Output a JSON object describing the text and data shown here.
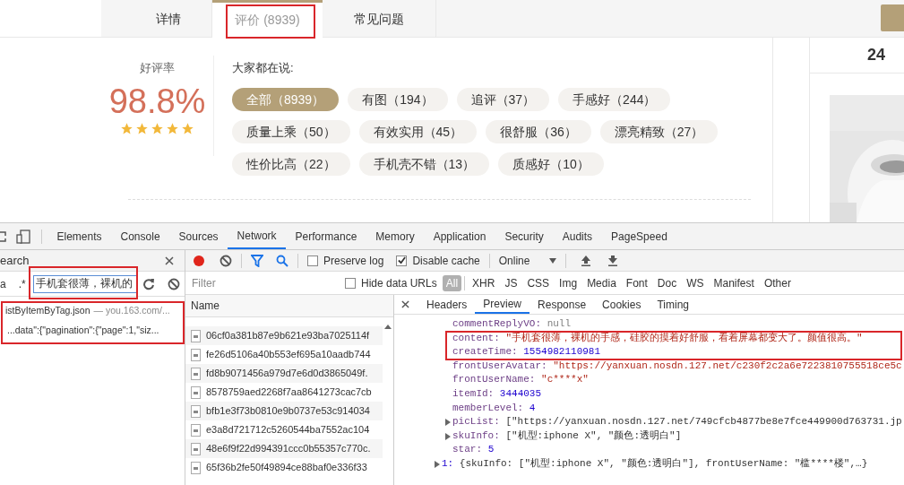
{
  "page": {
    "tabs": [
      {
        "label": "详情",
        "selected": false
      },
      {
        "label": "评价 (8939)",
        "selected": true
      },
      {
        "label": "常见问题",
        "selected": false
      }
    ],
    "rating": {
      "label": "好评率",
      "value": "98.8%",
      "stars": 5
    },
    "tags_title": "大家都在说:",
    "tag_rows": [
      [
        {
          "label": "全部（8939）",
          "selected": true
        },
        {
          "label": "有图（194）",
          "selected": false
        },
        {
          "label": "追评（37）",
          "selected": false
        },
        {
          "label": "手感好（244）",
          "selected": false
        }
      ],
      [
        {
          "label": "质量上乘（50）",
          "selected": false
        },
        {
          "label": "有效实用（45）",
          "selected": false
        },
        {
          "label": "很舒服（36）",
          "selected": false
        },
        {
          "label": "漂亮精致（27）",
          "selected": false
        }
      ],
      [
        {
          "label": "性价比高（22）",
          "selected": false
        },
        {
          "label": "手机壳不错（13）",
          "selected": false
        },
        {
          "label": "质感好（10）",
          "selected": false
        }
      ]
    ],
    "side_heading": "24"
  },
  "devtools": {
    "tabs": [
      {
        "label": "Elements",
        "selected": false
      },
      {
        "label": "Console",
        "selected": false
      },
      {
        "label": "Sources",
        "selected": false
      },
      {
        "label": "Network",
        "selected": true
      },
      {
        "label": "Performance",
        "selected": false
      },
      {
        "label": "Memory",
        "selected": false
      },
      {
        "label": "Application",
        "selected": false
      },
      {
        "label": "Security",
        "selected": false
      },
      {
        "label": "Audits",
        "selected": false
      },
      {
        "label": "PageSpeed",
        "selected": false
      }
    ],
    "search_panel": {
      "title": "earch",
      "case_label": "a",
      "regex_label": ".*",
      "query": "手机套很薄，裸机的",
      "result_file": "istByItemByTag.json",
      "result_source": "— you.163.com/...",
      "result_match": "...data\":{\"pagination\":{\"page\":1,\"siz..."
    },
    "toolbar": {
      "preserve_log": {
        "label": "Preserve log",
        "checked": false
      },
      "disable_cache": {
        "label": "Disable cache",
        "checked": true
      },
      "throttle": "Online"
    },
    "filter": {
      "placeholder": "Filter",
      "hide_data_urls": {
        "label": "Hide data URLs",
        "checked": false
      },
      "types": [
        {
          "label": "All",
          "selected": true
        },
        {
          "label": "XHR",
          "selected": false
        },
        {
          "label": "JS",
          "selected": false
        },
        {
          "label": "CSS",
          "selected": false
        },
        {
          "label": "Img",
          "selected": false
        },
        {
          "label": "Media",
          "selected": false
        },
        {
          "label": "Font",
          "selected": false
        },
        {
          "label": "Doc",
          "selected": false
        },
        {
          "label": "WS",
          "selected": false
        },
        {
          "label": "Manifest",
          "selected": false
        },
        {
          "label": "Other",
          "selected": false
        }
      ]
    },
    "name_header": "Name",
    "requests": [
      "06cf0a381b87e9b621e93ba7025114f",
      "fe26d5106a40b553ef695a10aadb744",
      "fd8b9071456a979d7e6d0d3865049f.",
      "8578759aed2268f7aa8641273cac7cb",
      "bfb1e3f73b0810e9b0737e53c914034",
      "e3a8d721712c5260544ba7552ac104",
      "48e6f9f22d994391ccc0b55357c770c.",
      "65f36b2fe50f49894ce88baf0e336f33"
    ],
    "detail_tabs": [
      {
        "label": "Headers",
        "selected": false
      },
      {
        "label": "Preview",
        "selected": true
      },
      {
        "label": "Response",
        "selected": false
      },
      {
        "label": "Cookies",
        "selected": false
      },
      {
        "label": "Timing",
        "selected": false
      }
    ],
    "preview_fields": [
      {
        "key": "commentReplyVO:",
        "value": "null",
        "kind": "null"
      },
      {
        "key": "content:",
        "value": "\"手机套很薄，裸机的手感，硅胶的摸着好舒服，看着屏幕都变大了。颜值很高。\"",
        "kind": "string"
      },
      {
        "key": "createTime:",
        "value": "1554982110981",
        "kind": "number"
      },
      {
        "key": "frontUserAvatar:",
        "value": "\"https://yanxuan.nosdn.127.net/c230f2c2a6e7223810755518ce5c",
        "kind": "string"
      },
      {
        "key": "frontUserName:",
        "value": "\"c****x\"",
        "kind": "string"
      },
      {
        "key": "itemId:",
        "value": "3444035",
        "kind": "number"
      },
      {
        "key": "memberLevel:",
        "value": "4",
        "kind": "number"
      },
      {
        "key": "picList:",
        "value": "[\"https://yanxuan.nosdn.127.net/749cfcb4877be8e7fce449900d763731.jp",
        "kind": "array",
        "expanded": false
      },
      {
        "key": "skuInfo:",
        "value": "[\"机型:iphone X\", \"颜色:透明白\"]",
        "kind": "array",
        "expanded": false
      },
      {
        "key": "star:",
        "value": "5",
        "kind": "number"
      }
    ],
    "preview_items": [
      {
        "index": "1:",
        "summary": "{skuInfo: [\"机型:iphone X\", \"颜色:透明白\"], frontUserName: \"槛****楼\",…}",
        "expanded": false
      }
    ]
  }
}
